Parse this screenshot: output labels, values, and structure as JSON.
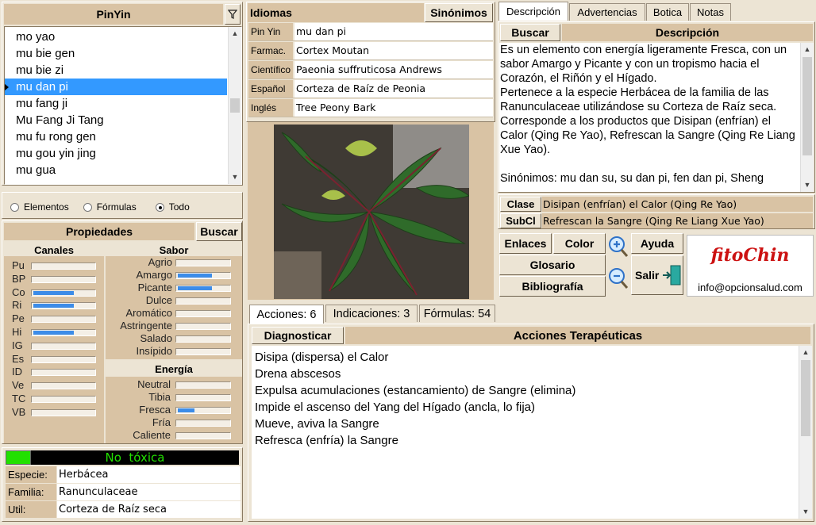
{
  "pinyin_panel": {
    "title": "PinYin",
    "filter_icon": "filter-icon",
    "items": [
      "mo yao",
      "mu bie gen",
      "mu bie zi",
      "mu dan pi",
      "mu fang ji",
      "Mu Fang Ji Tang",
      "mu fu rong gen",
      "mu gou yin jing",
      "mu gua"
    ],
    "selected_index": 3
  },
  "filter_radios": {
    "options": [
      "Elementos",
      "Fórmulas",
      "Todo"
    ],
    "selected": "Todo"
  },
  "propiedades": {
    "title": "Propiedades",
    "search_label": "Buscar",
    "canales": {
      "title": "Canales",
      "items": [
        {
          "label": "Pu",
          "level": 0
        },
        {
          "label": "BP",
          "level": 0
        },
        {
          "label": "Co",
          "level": 0.65
        },
        {
          "label": "Ri",
          "level": 0.65
        },
        {
          "label": "Pe",
          "level": 0
        },
        {
          "label": "Hi",
          "level": 0.65
        },
        {
          "label": "IG",
          "level": 0
        },
        {
          "label": "Es",
          "level": 0
        },
        {
          "label": "ID",
          "level": 0
        },
        {
          "label": "Ve",
          "level": 0
        },
        {
          "label": "TC",
          "level": 0
        },
        {
          "label": "VB",
          "level": 0
        }
      ]
    },
    "sabor": {
      "title": "Sabor",
      "items": [
        {
          "label": "Agrio",
          "level": 0
        },
        {
          "label": "Amargo",
          "level": 0.65
        },
        {
          "label": "Picante",
          "level": 0.65
        },
        {
          "label": "Dulce",
          "level": 0
        },
        {
          "label": "Aromático",
          "level": 0
        },
        {
          "label": "Astringente",
          "level": 0
        },
        {
          "label": "Salado",
          "level": 0
        },
        {
          "label": "Insípido",
          "level": 0
        }
      ]
    },
    "energia": {
      "title": "Energía",
      "items": [
        {
          "label": "Neutral",
          "level": 0
        },
        {
          "label": "Tibia",
          "level": 0
        },
        {
          "label": "Fresca",
          "level": 0.32
        },
        {
          "label": "Fría",
          "level": 0
        },
        {
          "label": "Caliente",
          "level": 0
        }
      ]
    }
  },
  "toxicity": {
    "label": "No  tóxica",
    "color": "#22e000"
  },
  "info": {
    "rows": [
      {
        "key": "Especie:",
        "value": "Herbácea"
      },
      {
        "key": "Familia:",
        "value": "Ranunculaceae"
      },
      {
        "key": "Util:",
        "value": "Corteza de Raíz seca"
      }
    ]
  },
  "idiomas": {
    "title": "Idiomas",
    "sinonimos_label": "Sinónimos",
    "rows": [
      {
        "key": "Pin Yin",
        "value": "mu dan pi"
      },
      {
        "key": "Farmac.",
        "value": "Cortex Moutan"
      },
      {
        "key": "Científico",
        "value": "Paeonia suffruticosa Andrews"
      },
      {
        "key": "Español",
        "value": "Corteza de Raíz de Peonia"
      },
      {
        "key": "Inglés",
        "value": "Tree Peony Bark"
      }
    ]
  },
  "desc_tabs": {
    "tabs": [
      "Descripción",
      "Advertencias",
      "Botica",
      "Notas"
    ],
    "active": 0,
    "search_label": "Buscar",
    "header": "Descripción",
    "paragraphs": [
      "Es un elemento con energía ligeramente Fresca, con un sabor Amargo y Picante y con un tropismo hacia el Corazón, el Riñón y el Hígado.",
      "Pertenece a la especie Herbácea de la familia de las Ranunculaceae utilizándose su Corteza de Raíz seca.",
      "Corresponde a los productos que Disipan (enfrían) el Calor (Qing Re Yao), Refrescan la Sangre (Qing Re Liang Xue Yao).",
      "",
      "Sinónimos: mu dan su, su dan pi, fen dan pi, Sheng"
    ]
  },
  "clase": {
    "clase_label": "Clase",
    "clase_value": "Disipan (enfrían) el Calor (Qing Re Yao)",
    "subcl_label": "SubCl",
    "subcl_value": "Refrescan la Sangre (Qing Re Liang Xue Yao)"
  },
  "tools": {
    "enlaces": "Enlaces",
    "color": "Color",
    "ayuda": "Ayuda",
    "glosario": "Glosario",
    "salir": "Salir",
    "bibliografia": "Bibliografía",
    "zoom_in_icon": "zoom-in-icon",
    "zoom_out_icon": "zoom-out-icon",
    "exit_icon": "exit-door-icon"
  },
  "logo": {
    "brand": "fitoChin",
    "email": "info@opcionsalud.com",
    "color": "#cc1111"
  },
  "lower_tabs": {
    "tabs": [
      "Acciones: 6",
      "Indicaciones: 3",
      "Fórmulas: 54"
    ],
    "active": 0,
    "diagnosticar_label": "Diagnosticar",
    "header": "Acciones Terapéuticas",
    "items": [
      "Disipa (dispersa) el Calor",
      "Drena abscesos",
      "Expulsa acumulaciones (estancamiento) de Sangre (elimina)",
      "Impide el ascenso del Yang del Hígado (ancla, lo fija)",
      "Mueve, aviva la Sangre",
      "Refresca (enfría) la Sangre"
    ]
  }
}
